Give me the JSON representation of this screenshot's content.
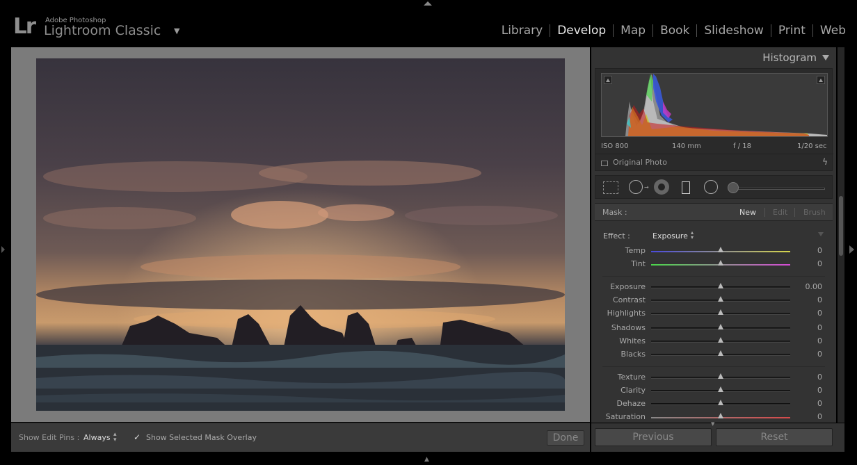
{
  "app": {
    "logo": "Lr",
    "brand_small": "Adobe Photoshop",
    "brand_big": "Lightroom Classic",
    "brand_arrow": "▼"
  },
  "modules": [
    "Library",
    "Develop",
    "Map",
    "Book",
    "Slideshow",
    "Print",
    "Web"
  ],
  "active_module": "Develop",
  "toolbar": {
    "edit_pins_label": "Show Edit Pins :",
    "edit_pins_value": "Always",
    "overlay_checked": true,
    "overlay_label": "Show Selected Mask Overlay",
    "done_label": "Done"
  },
  "histogram": {
    "title": "Histogram",
    "iso": "ISO 800",
    "focal": "140 mm",
    "aperture": "f / 18",
    "shutter": "1/20 sec",
    "original_photo_label": "Original Photo"
  },
  "mask": {
    "label": "Mask :",
    "new_label": "New",
    "edit_label": "Edit",
    "brush_label": "Brush"
  },
  "effect": {
    "label": "Effect :",
    "value": "Exposure"
  },
  "sliders": [
    {
      "label": "Temp",
      "value": "0",
      "position": 0.5
    },
    {
      "label": "Tint",
      "value": "0",
      "position": 0.5
    },
    {
      "label": "Exposure",
      "value": "0.00",
      "position": 0.5
    },
    {
      "label": "Contrast",
      "value": "0",
      "position": 0.5
    },
    {
      "label": "Highlights",
      "value": "0",
      "position": 0.5
    },
    {
      "label": "Shadows",
      "value": "0",
      "position": 0.5
    },
    {
      "label": "Whites",
      "value": "0",
      "position": 0.5
    },
    {
      "label": "Blacks",
      "value": "0",
      "position": 0.5
    },
    {
      "label": "Texture",
      "value": "0",
      "position": 0.5
    },
    {
      "label": "Clarity",
      "value": "0",
      "position": 0.5
    },
    {
      "label": "Dehaze",
      "value": "0",
      "position": 0.5
    },
    {
      "label": "Saturation",
      "value": "0",
      "position": 0.5
    }
  ],
  "buttons": {
    "previous": "Previous",
    "reset": "Reset"
  },
  "colors": {
    "temp_gradient": [
      "#4a4adb",
      "#d6d64a"
    ],
    "tint_gradient": [
      "#4ad64a",
      "#d64ad6"
    ],
    "saturation_gradient": [
      "#888888",
      "#d64a4a"
    ]
  }
}
